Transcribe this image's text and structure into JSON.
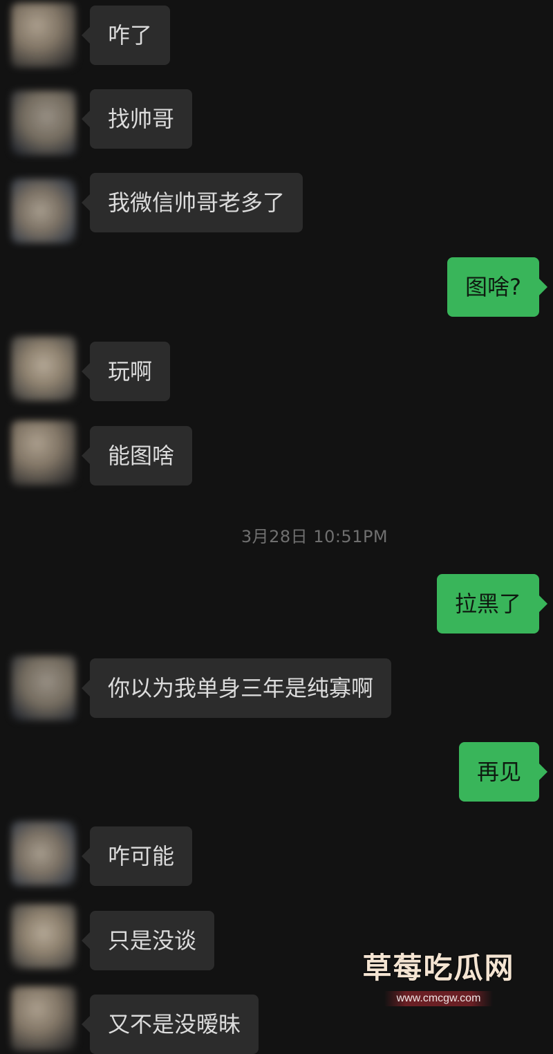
{
  "conversation": {
    "messages": [
      {
        "side": "in",
        "text": "咋了"
      },
      {
        "side": "in",
        "text": "找帅哥"
      },
      {
        "side": "in",
        "text": "我微信帅哥老多了"
      },
      {
        "side": "out",
        "text": "图啥?"
      },
      {
        "side": "in",
        "text": "玩啊"
      },
      {
        "side": "in",
        "text": "能图啥"
      },
      {
        "side": "out",
        "text": "拉黑了"
      },
      {
        "side": "in",
        "text": "你以为我单身三年是纯寡啊"
      },
      {
        "side": "out",
        "text": "再见"
      },
      {
        "side": "in",
        "text": "咋可能"
      },
      {
        "side": "in",
        "text": "只是没谈"
      },
      {
        "side": "in",
        "text": "又不是没暧昧"
      }
    ],
    "timestamp": "3月28日 10:51PM"
  },
  "watermark": {
    "title": "草莓吃瓜网",
    "url": "www.cmcgw.com"
  },
  "colors": {
    "background": "#121212",
    "incoming_bubble": "#2c2c2c",
    "outgoing_bubble": "#39b55a",
    "timestamp_text": "#6f6f6f"
  },
  "icons": {
    "contact_avatar": "avatar-icon"
  }
}
